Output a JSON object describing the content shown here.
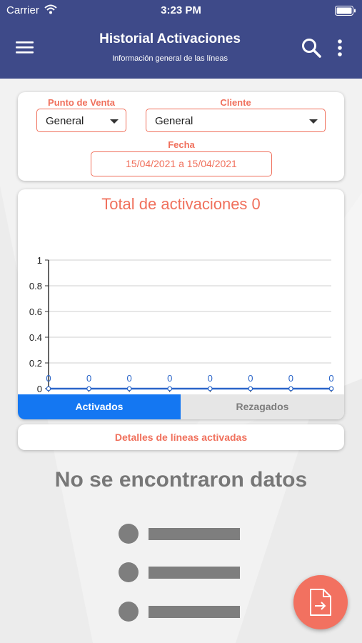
{
  "status_bar": {
    "carrier": "Carrier",
    "time": "3:23 PM"
  },
  "app_bar": {
    "title": "Historial Activaciones",
    "subtitle": "Información general de las líneas"
  },
  "filters": {
    "punto_de_venta": {
      "label": "Punto de Venta",
      "value": "General"
    },
    "cliente": {
      "label": "Cliente",
      "value": "General"
    },
    "fecha": {
      "label": "Fecha",
      "value": "15/04/2021 a 15/04/2021"
    }
  },
  "chart_card": {
    "title": "Total de activaciones 0"
  },
  "chart_data": {
    "type": "line",
    "title": "Total de activaciones 0",
    "yticks": [
      "1",
      "0.8",
      "0.6",
      "0.4",
      "0.2",
      "0"
    ],
    "ylim": [
      0,
      1
    ],
    "grid": true,
    "series": [
      {
        "values": [
          0,
          0,
          0,
          0,
          0,
          0,
          0,
          0
        ],
        "data_labels": [
          "0",
          "0",
          "0",
          "0",
          "0",
          "0",
          "0",
          "0"
        ]
      }
    ]
  },
  "tabs": {
    "active": "Activados",
    "inactive": "Rezagados"
  },
  "details": {
    "label": "Detalles de líneas activadas"
  },
  "empty_state": {
    "message": "No se encontraron datos"
  },
  "colors": {
    "primary": "#3e4a89",
    "accent": "#f0705c",
    "tab_active": "#1477f2",
    "line": "#2a65c9"
  },
  "icons": [
    "wifi-icon",
    "battery-icon",
    "menu-icon",
    "search-icon",
    "more-vert-icon",
    "caret-down-icon",
    "file-export-icon"
  ]
}
